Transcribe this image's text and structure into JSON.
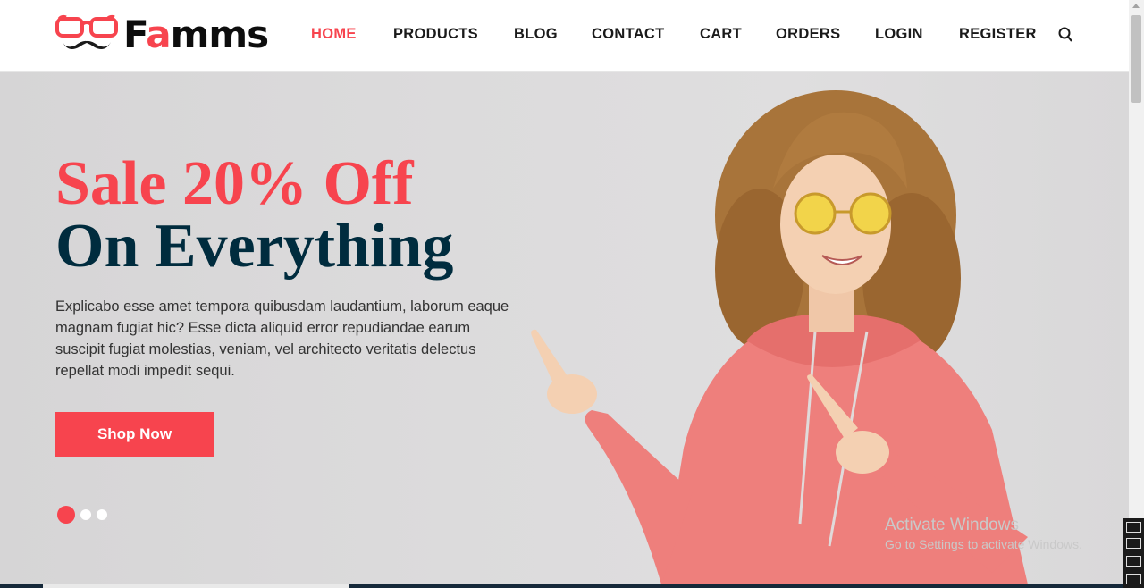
{
  "brand": {
    "name_prefix": "F",
    "name_accent": "a",
    "name_suffix": "mms"
  },
  "nav": {
    "items": [
      {
        "label": "HOME",
        "active": true
      },
      {
        "label": "PRODUCTS",
        "active": false
      },
      {
        "label": "BLOG",
        "active": false
      },
      {
        "label": "CONTACT",
        "active": false
      },
      {
        "label": "CART",
        "active": false
      },
      {
        "label": "ORDERS",
        "active": false
      },
      {
        "label": "LOGIN",
        "active": false
      },
      {
        "label": "REGISTER",
        "active": false
      }
    ],
    "search_icon": "search-icon"
  },
  "hero": {
    "title_line1": "Sale 20% Off",
    "title_line2": "On Everything",
    "description": "Explicabo esse amet tempora quibusdam laudantium, laborum eaque magnam fugiat hic? Esse dicta aliquid error repudiandae earum suscipit fugiat molestias, veniam, vel architecto veritatis delectus repellat modi impedit sequi.",
    "cta_label": "Shop Now",
    "slides_count": 3,
    "active_slide": 1
  },
  "watermark": {
    "title": "Activate Windows",
    "subtitle": "Go to Settings to activate Windows."
  },
  "colors": {
    "accent": "#f7444e",
    "dark": "#002c3e",
    "text": "#333333"
  }
}
